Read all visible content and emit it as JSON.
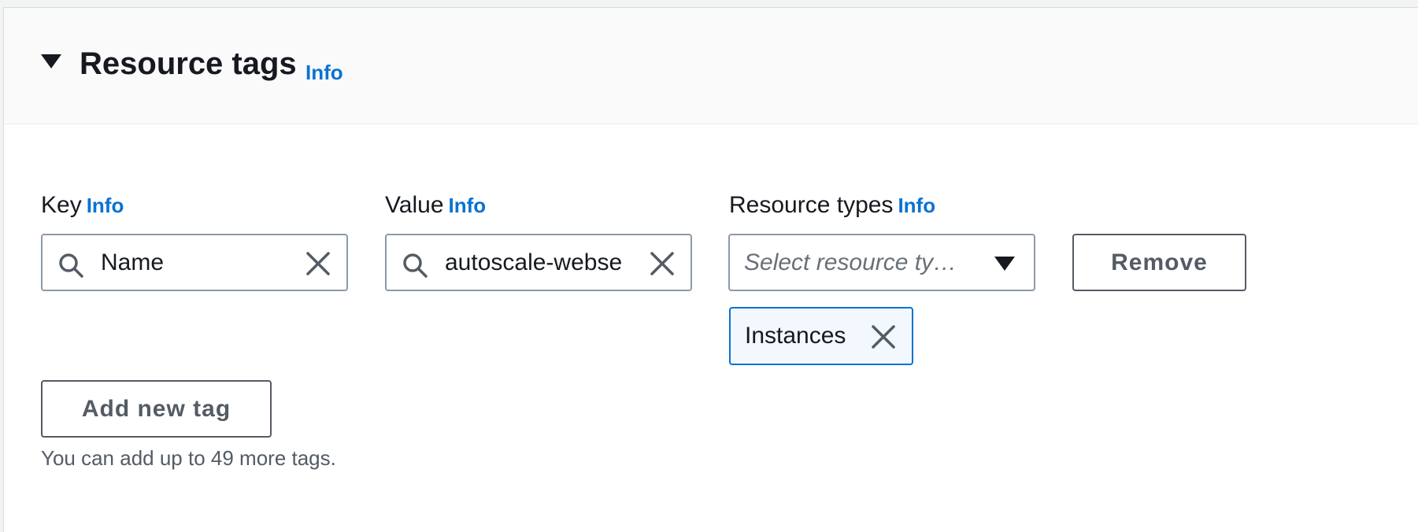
{
  "section": {
    "title": "Resource tags",
    "info_label": "Info"
  },
  "tag": {
    "key": {
      "label": "Key",
      "info_label": "Info",
      "value": "Name"
    },
    "value": {
      "label": "Value",
      "info_label": "Info",
      "value": "autoscale-webse"
    },
    "resource_types": {
      "label": "Resource types",
      "info_label": "Info",
      "placeholder": "Select resource ty…",
      "selected_tokens": [
        "Instances"
      ]
    },
    "remove_label": "Remove"
  },
  "add_tag_label": "Add new tag",
  "hint_text": "You can add up to 49 more tags.",
  "icons": {
    "expand": "caret-down-icon",
    "search": "search-icon",
    "clear": "close-icon",
    "dropdown": "caret-down-icon"
  },
  "colors": {
    "info_link": "#0972d3",
    "token_border": "#0972d3",
    "token_background": "#f2f8fd",
    "button_border": "#545b64",
    "input_border": "#8d99a8",
    "header_background": "#fafafa"
  }
}
